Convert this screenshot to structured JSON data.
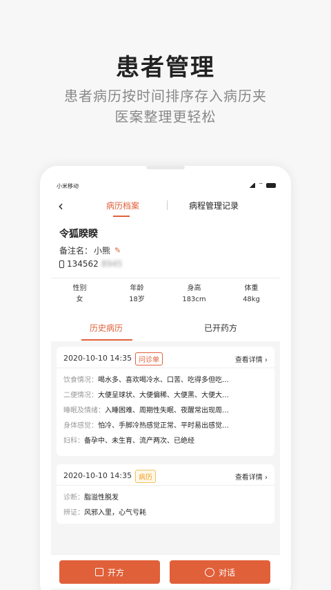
{
  "promo": {
    "title": "患者管理",
    "subtitle_line1": "患者病历按时间排序存入病历夹",
    "subtitle_line2": "医案整理更轻松"
  },
  "status_bar": {
    "carrier": "小米移动"
  },
  "nav": {
    "back_icon": "‹",
    "tab_records": "病历档案",
    "tab_course": "病程管理记录"
  },
  "patient": {
    "name": "令狐睽睽",
    "note_label": "备注名：",
    "note_value": "小熊",
    "phone": "134562",
    "phone_masked": "8945"
  },
  "stats": [
    {
      "label": "性别",
      "value": "女"
    },
    {
      "label": "年龄",
      "value": "18岁"
    },
    {
      "label": "身高",
      "value": "183cm"
    },
    {
      "label": "体重",
      "value": "48kg"
    }
  ],
  "sub_tabs": {
    "history": "历史病历",
    "prescribed": "已开药方"
  },
  "records": [
    {
      "date": "2020-10-10 14:35",
      "tag": "问诊单",
      "link": "查看详情",
      "rows": [
        {
          "k": "饮食情况：",
          "v": "喝水多、喜欢喝冷水、口苦、吃得多但吃…"
        },
        {
          "k": "二便情况：",
          "v": "大便呈球状、大便偏稀、大便黑、大便大…"
        },
        {
          "k": "睡眠及情绪：",
          "v": "入睡困难、周期性失眠、夜醒常出现周…"
        },
        {
          "k": "身体感觉：",
          "v": "怕冷、手脚冷热感觉正常、平时易出感觉…"
        },
        {
          "k": "妇科：",
          "v": "备孕中、未生育、流产两次、已绝经"
        }
      ]
    },
    {
      "date": "2020-10-10 14:35",
      "tag": "病历",
      "link": "查看详情",
      "rows": [
        {
          "k": "诊断：",
          "v": "脂溢性脱发"
        },
        {
          "k": "辨证：",
          "v": "风邪入里，心气亏耗"
        }
      ]
    }
  ],
  "actions": {
    "prescribe": "开方",
    "chat": "对话"
  },
  "colors": {
    "accent": "#e0603a",
    "tag_orange": "#f0a020"
  }
}
